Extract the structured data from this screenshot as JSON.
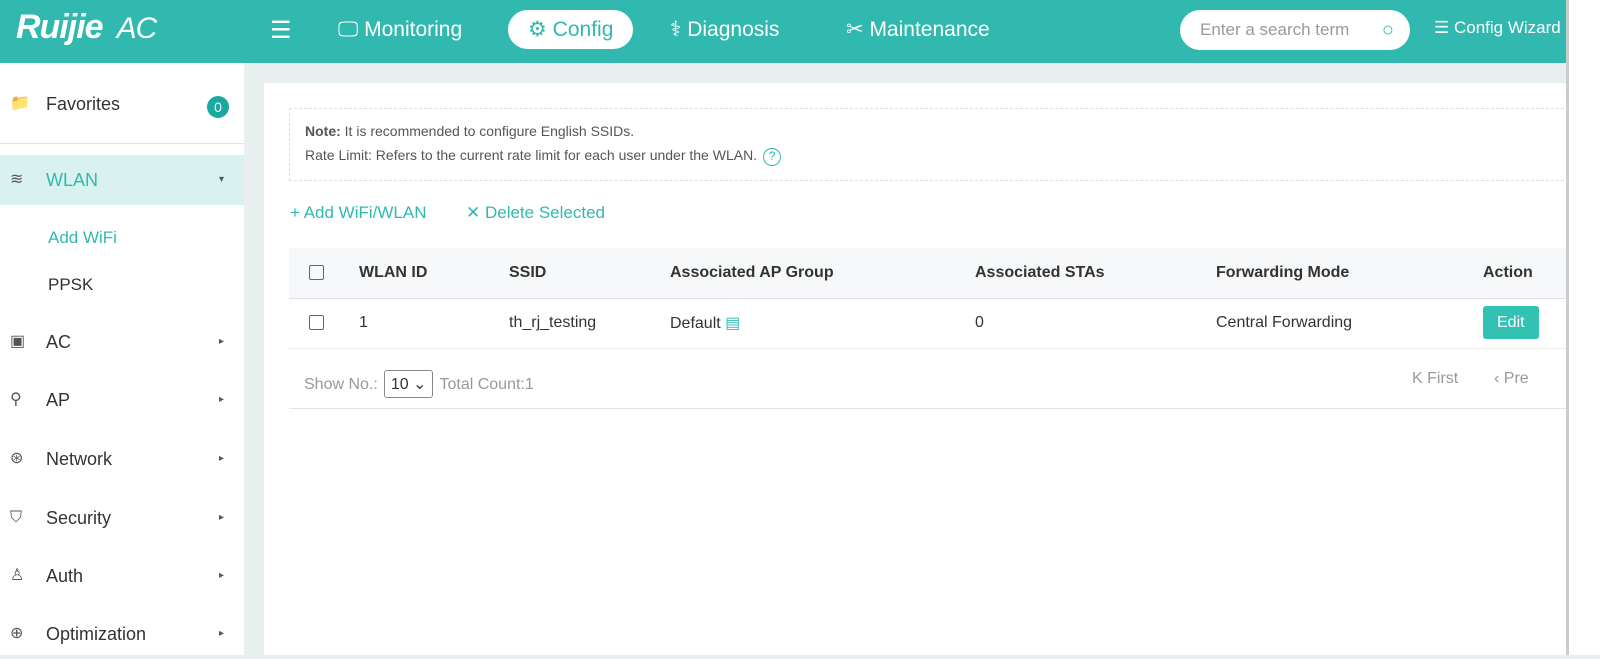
{
  "header": {
    "logo": "Ruijie",
    "product": "AC",
    "nav": [
      "Monitoring",
      "Config",
      "Diagnosis",
      "Maintenance"
    ],
    "search_placeholder": "Enter a search term",
    "wizard": "Config Wizard"
  },
  "sidebar": {
    "favorites": "Favorites",
    "favorites_count": "0",
    "items": [
      {
        "label": "WLAN"
      },
      {
        "label": "AC"
      },
      {
        "label": "AP"
      },
      {
        "label": "Network"
      },
      {
        "label": "Security"
      },
      {
        "label": "Auth"
      },
      {
        "label": "Optimization"
      }
    ],
    "sub": [
      "Add WiFi",
      "PPSK"
    ]
  },
  "note": {
    "label": "Note:",
    "line1": "It is recommended to configure English SSIDs.",
    "line2": "Rate Limit: Refers to the current rate limit for each user under the WLAN."
  },
  "actions": {
    "add": "+ Add WiFi/WLAN",
    "delete": "✕ Delete Selected"
  },
  "table": {
    "headers": [
      "WLAN ID",
      "SSID",
      "Associated AP Group",
      "Associated STAs",
      "Forwarding Mode",
      "Action"
    ],
    "rows": [
      {
        "id": "1",
        "ssid": "th_rj_testing",
        "group": "Default",
        "stas": "0",
        "mode": "Central Forwarding",
        "edit": "Edit"
      }
    ]
  },
  "pager": {
    "show": "Show No.:",
    "size": "10",
    "total": "Total Count:1",
    "first": "First",
    "prev": "Pre"
  },
  "colors": {
    "accent": "#32b9af"
  }
}
